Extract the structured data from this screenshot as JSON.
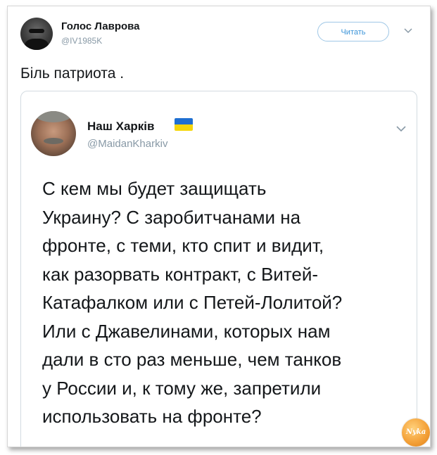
{
  "outer_tweet": {
    "name": "Голос Лаврова",
    "handle": "@IV1985K",
    "follow_label": "Читать",
    "text": "Біль патриота ."
  },
  "quoted_tweet": {
    "name": "Наш Харків",
    "handle": "@MaidanKharkiv",
    "flag_icon": "ukraine-flag",
    "lines": [
      "С кем мы будет защищать",
      "Украину? С заробитчанами на",
      "фронте, с теми, кто спит и видит,",
      "как разорвать контракт, с Витей-",
      "Катафалком или с Петей-Лолитой?",
      "Или с Джавелинами, которых нам",
      "дали в сто раз меньше, чем танков",
      "у России и, к тому же, запретили",
      "использовать на фронте?"
    ]
  },
  "watermark": {
    "label": "Nyka"
  },
  "colors": {
    "accent": "#3b94d9",
    "handle_grey": "#8899a6",
    "text": "#14171a",
    "flag_blue": "#1f6fd1",
    "flag_yellow": "#f5d60a"
  }
}
